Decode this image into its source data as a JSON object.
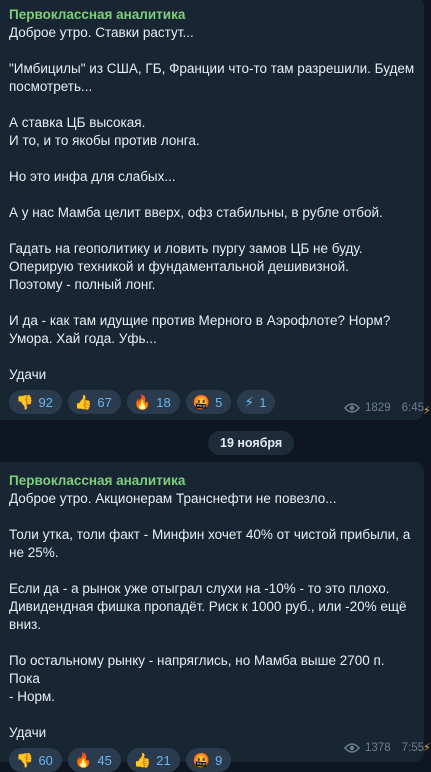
{
  "messages": [
    {
      "sender": "Первоклассная аналитика",
      "lines": [
        "Доброе утро. Ставки растут...",
        "",
        "\"Имбицилы\" из США, ГБ, Франции что-то там разрешили. Будем",
        "посмотреть...",
        "",
        "А ставка ЦБ высокая.",
        "И то, и то якобы против лонга.",
        "",
        "Но это инфа для слабых...",
        "",
        "А у нас Мамба целит вверх, офз стабильны, в рубле отбой.",
        "",
        "Гадать на геополитику и ловить пургу замов ЦБ не буду.",
        "Оперирую техникой и фундаментальной дешивизной.",
        "Поэтому - полный лонг.",
        "",
        "И да - как там идущие против Мерного в Аэрофлоте? Норм?",
        "Умора. Хай года. Уфь...",
        "",
        "Удачи"
      ],
      "reactions": [
        {
          "emoji": "👎",
          "count": "92"
        },
        {
          "emoji": "👍",
          "count": "67"
        },
        {
          "emoji": "🔥",
          "count": "18"
        },
        {
          "emoji": "🤬",
          "count": "5"
        },
        {
          "emoji": "⚡",
          "count": "1"
        }
      ],
      "views": "1829",
      "time": "6:45"
    },
    {
      "sender": "Первоклассная аналитика",
      "lines": [
        "Доброе утро. Акционерам Транснефти не повезло...",
        "",
        "Толи утка, толи факт - Минфин хочет 40% от чистой прибыли, а",
        "не 25%.",
        "",
        "Если да - а рынок уже отыграл слухи на -10% - то это плохо.",
        "Дивидендная фишка пропадёт. Риск к 1000 руб., или -20% ещё",
        "вниз.",
        "",
        "По остальному рынку - напряглись, но Мамба выше 2700 п. Пока",
        "- Норм.",
        "",
        "Удачи"
      ],
      "reactions": [
        {
          "emoji": "👎",
          "count": "60"
        },
        {
          "emoji": "🔥",
          "count": "45"
        },
        {
          "emoji": "👍",
          "count": "21"
        },
        {
          "emoji": "🤬",
          "count": "9"
        }
      ],
      "views": "1378",
      "time": "7:55"
    }
  ],
  "date_separator": "19 ноября",
  "colors": {
    "background": "#0e1621",
    "bubble": "#182533",
    "sender": "#7fce7a",
    "reaction_count": "#6cb4f0"
  },
  "icons": {
    "views": "eye-icon",
    "side": "boost-icon"
  }
}
